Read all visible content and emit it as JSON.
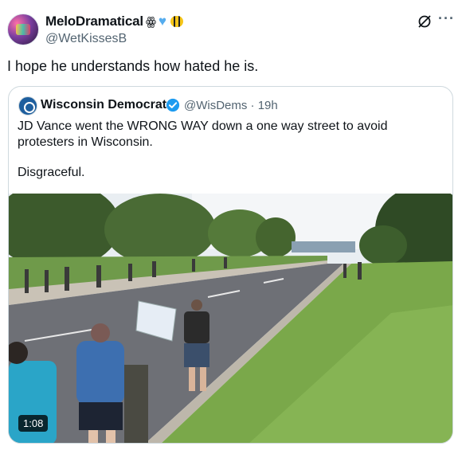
{
  "author": {
    "display_name": "MeloDramatical",
    "handle": "@WetKissesB",
    "name_emojis": [
      "hat-icon",
      "blue-heart-icon",
      "bee-icon"
    ]
  },
  "tweet": {
    "text": "I hope he understands how hated he is."
  },
  "quoted": {
    "name": "Wisconsin Democrats",
    "handle_time": "@WisDems · 19h",
    "text": "JD Vance went the WRONG WAY down a one way street to avoid protesters in Wisconsin.",
    "text2": "Disgraceful.",
    "video_duration": "1:08"
  },
  "colors": {
    "verified": "#1d9bf0",
    "secondary_text": "#536471",
    "border": "#cfd9de"
  }
}
